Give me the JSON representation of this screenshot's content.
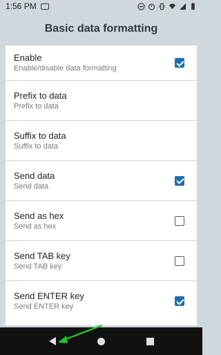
{
  "status_bar": {
    "time": "1:56 PM",
    "icons": [
      "app-indicator-icon",
      "do-not-disturb-icon",
      "alarm-icon",
      "vibrate-icon",
      "wifi-icon",
      "signal-icon",
      "battery-icon"
    ]
  },
  "header": {
    "title": "Basic data formatting"
  },
  "settings": [
    {
      "label": "Enable",
      "sub": "Enable/disable data formatting",
      "checkbox": true,
      "checked": true
    },
    {
      "label": "Prefix to data",
      "sub": "Prefix to data",
      "checkbox": false,
      "checked": false
    },
    {
      "label": "Suffix to data",
      "sub": "Suffix to data",
      "checkbox": false,
      "checked": false
    },
    {
      "label": "Send data",
      "sub": "Send data",
      "checkbox": true,
      "checked": true
    },
    {
      "label": "Send as hex",
      "sub": "Send as hex",
      "checkbox": true,
      "checked": false
    },
    {
      "label": "Send TAB key",
      "sub": "Send TAB key",
      "checkbox": true,
      "checked": false
    },
    {
      "label": "Send ENTER key",
      "sub": "Send ENTER key",
      "checkbox": true,
      "checked": true
    }
  ],
  "nav_bar": {
    "icons": [
      "back-icon",
      "home-icon",
      "recents-icon"
    ]
  },
  "colors": {
    "accent": "#1e6fb0",
    "background": "#cfd8dc",
    "annotation_arrow": "#22c32a"
  }
}
